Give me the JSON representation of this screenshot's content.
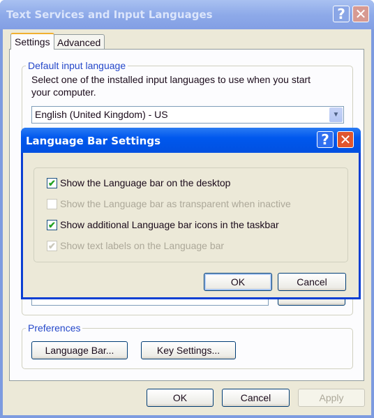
{
  "window": {
    "title": "Text Services and Input Languages",
    "help_icon": "?",
    "close_icon": "✕"
  },
  "tabs": [
    {
      "label": "Settings",
      "active": true
    },
    {
      "label": "Advanced",
      "active": false
    }
  ],
  "default_group": {
    "label": "Default input language",
    "description": "Select one of the installed input languages to use when you start your computer.",
    "selected": "English (United Kingdom) - US"
  },
  "preferences": {
    "label": "Preferences",
    "language_bar": "Language Bar...",
    "key_settings": "Key Settings..."
  },
  "footer": {
    "ok": "OK",
    "cancel": "Cancel",
    "apply": "Apply"
  },
  "modal": {
    "title": "Language Bar Settings",
    "options": [
      {
        "label": "Show the Language bar on the desktop",
        "checked": true,
        "enabled": true
      },
      {
        "label": "Show the Language bar as transparent when inactive",
        "checked": false,
        "enabled": false
      },
      {
        "label": "Show additional Language bar icons in the taskbar",
        "checked": true,
        "enabled": true
      },
      {
        "label": "Show text labels on the Language bar",
        "checked": true,
        "enabled": false
      }
    ],
    "ok": "OK",
    "cancel": "Cancel"
  }
}
